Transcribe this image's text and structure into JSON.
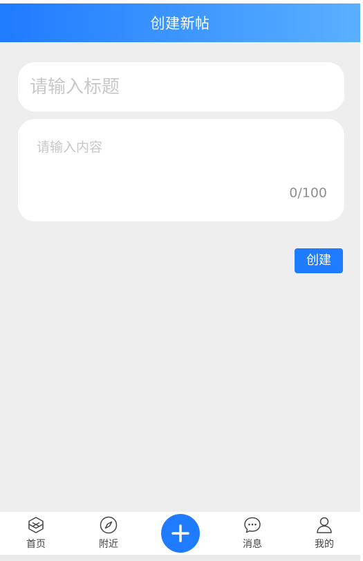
{
  "header": {
    "title": "创建新帖"
  },
  "form": {
    "title_placeholder": "请输入标题",
    "content_placeholder": "请输入内容",
    "counter": "0/100",
    "create_label": "创建"
  },
  "tabbar": {
    "items": [
      {
        "label": "首页",
        "icon": "cube-icon"
      },
      {
        "label": "附近",
        "icon": "compass-icon"
      },
      {
        "label": "",
        "icon": "plus-icon"
      },
      {
        "label": "消息",
        "icon": "chat-bubble-icon"
      },
      {
        "label": "我的",
        "icon": "user-icon"
      }
    ]
  },
  "colors": {
    "accent": "#1f7bff",
    "header_gradient_end": "#5ab0ff",
    "background": "#eeeeee"
  }
}
